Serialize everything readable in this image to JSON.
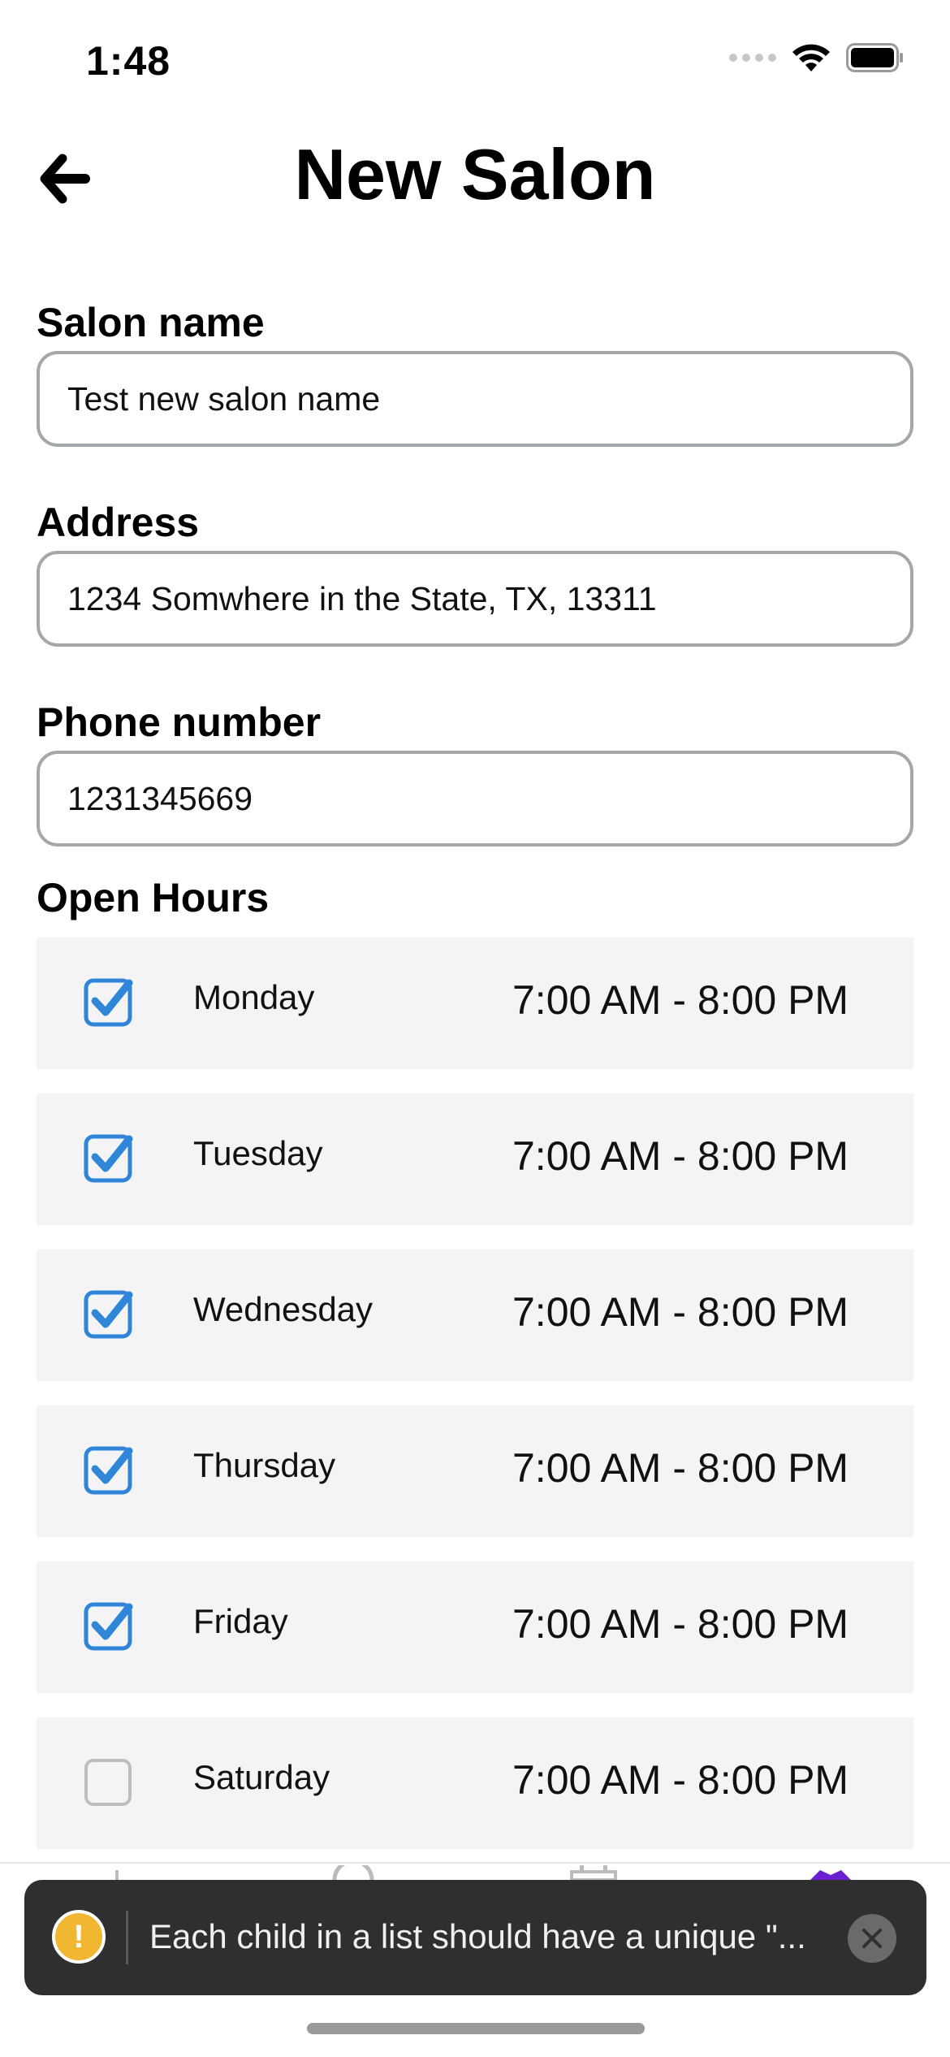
{
  "status_bar": {
    "time": "1:48"
  },
  "header": {
    "title": "New Salon"
  },
  "form": {
    "salon_name": {
      "label": "Salon name",
      "value": "Test new salon name"
    },
    "address": {
      "label": "Address",
      "value": "1234 Somwhere in the State, TX, 13311"
    },
    "phone": {
      "label": "Phone number",
      "value": "1231345669"
    }
  },
  "open_hours": {
    "label": "Open Hours",
    "days": [
      {
        "name": "Monday",
        "hours": "7:00 AM - 8:00 PM",
        "checked": true
      },
      {
        "name": "Tuesday",
        "hours": "7:00 AM - 8:00 PM",
        "checked": true
      },
      {
        "name": "Wednesday",
        "hours": "7:00 AM - 8:00 PM",
        "checked": true
      },
      {
        "name": "Thursday",
        "hours": "7:00 AM - 8:00 PM",
        "checked": true
      },
      {
        "name": "Friday",
        "hours": "7:00 AM - 8:00 PM",
        "checked": true
      },
      {
        "name": "Saturday",
        "hours": "7:00 AM - 8:00 PM",
        "checked": false
      }
    ]
  },
  "toast": {
    "message": "Each child in a list should have a unique \"..."
  },
  "colors": {
    "accent": "#2f86d8",
    "toast_bg": "#2f2f2f",
    "warning": "#f2b731",
    "tab_active": "#6a1fd1"
  },
  "icons": [
    "back-arrow-icon",
    "signal-icon",
    "wifi-icon",
    "battery-icon",
    "checkbox-checked-icon",
    "checkbox-empty-icon",
    "warning-icon",
    "close-icon"
  ]
}
